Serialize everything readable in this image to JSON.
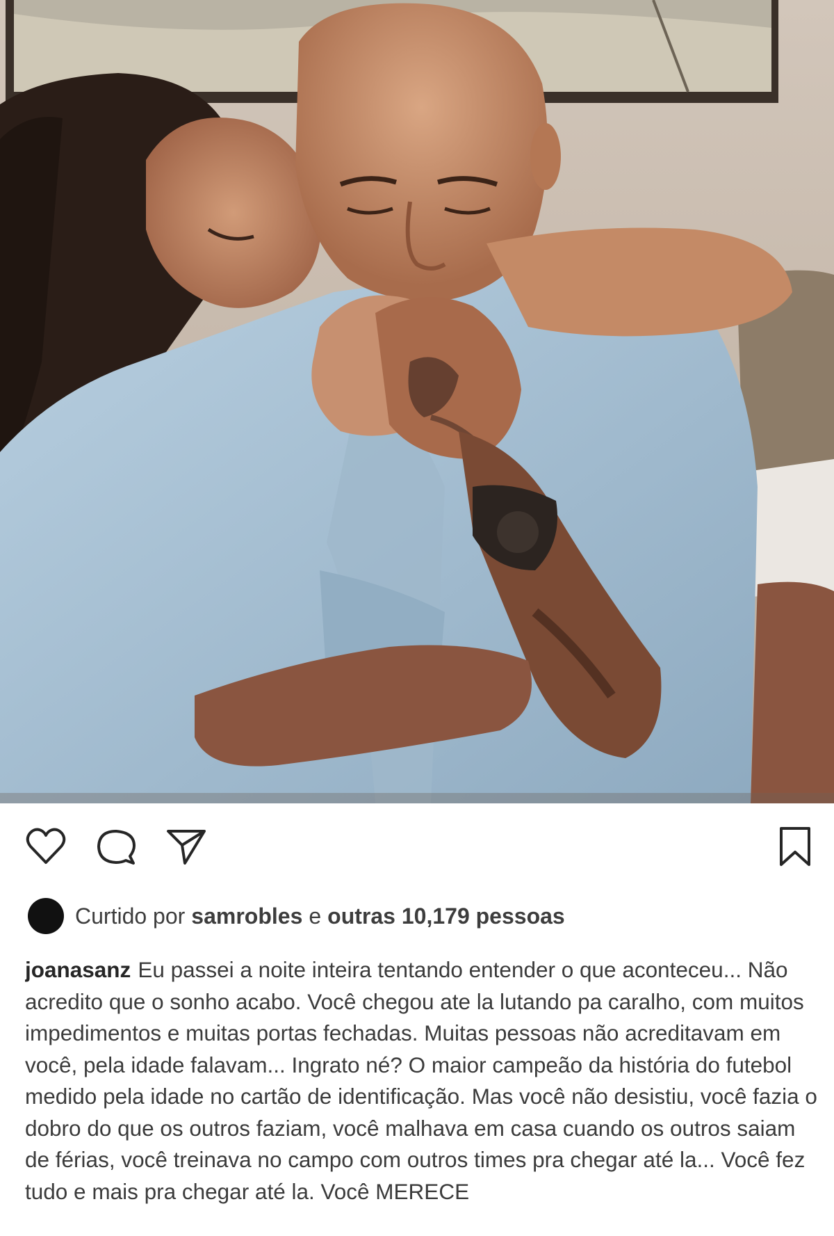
{
  "post": {
    "photo": {
      "alt": "",
      "colors": {
        "wall": "#c9bcaf",
        "frame": "#3a3029",
        "shirt": "#a9c3d6",
        "hair": "#2a1d17",
        "skin_light": "#c48a66",
        "skin_dark": "#7a4a34",
        "pillow": "#8d7c68"
      }
    },
    "actions": {
      "like_icon": "heart-icon",
      "comment_icon": "comment-bubble-icon",
      "share_icon": "paper-plane-icon",
      "save_icon": "bookmark-icon"
    },
    "likes": {
      "prefix": "Curtido por",
      "user": "samrobles",
      "middle": "e",
      "others": "outras 10,179 pessoas"
    },
    "caption": {
      "username": "joanasanz",
      "text": "Eu passei a noite inteira tentando entender o que aconteceu... Não acredito que o sonho acabo. Você chegou ate la lutando pa caralho, com muitos impedimentos e muitas portas fechadas. Muitas pessoas não acreditavam em você, pela idade falavam... Ingrato né? O maior campeão da história do futebol medido pela idade no cartão de identificação. Mas você não desistiu, você fazia o dobro do que os outros faziam, você malhava em casa cuando os outros saiam de férias, você treinava no campo com outros times pra chegar até la... Você fez tudo e mais pra chegar até la. Você MERECE"
    }
  }
}
